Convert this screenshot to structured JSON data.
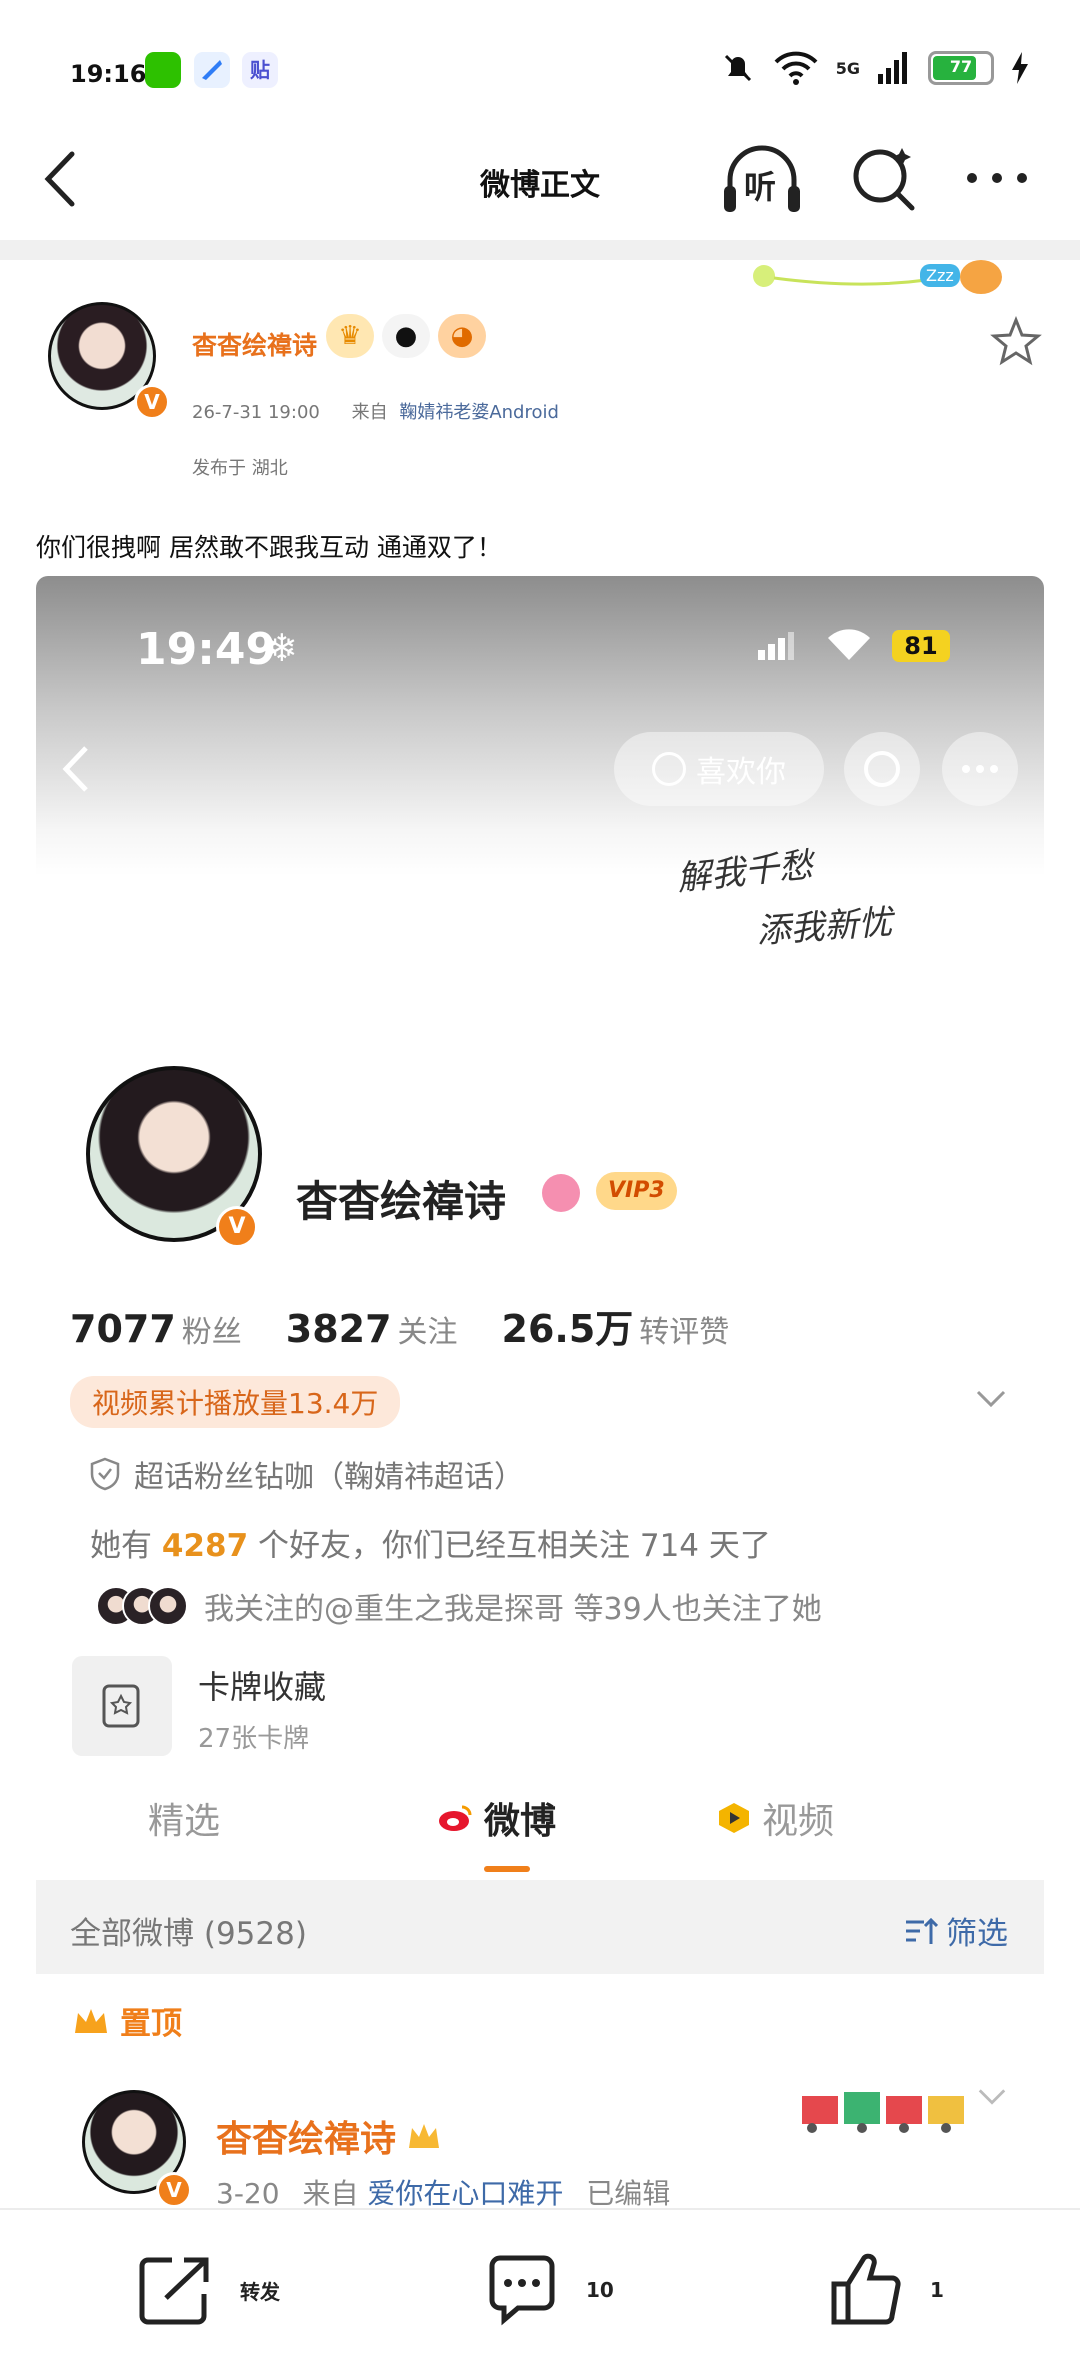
{
  "status_bar": {
    "time": "19:16",
    "tie_icon_text": "贴",
    "network": "5G",
    "battery": 77,
    "battery_text": "77"
  },
  "nav": {
    "title": "微博正文",
    "listen_label": "听"
  },
  "post": {
    "username": "杳杳绘禕诗",
    "meta_time": "26-7-31 19:00",
    "meta_from": "来自",
    "source": "鞠婧祎老婆Android",
    "location": "发布于 湖北",
    "text": "你们很拽啊 居然敢不跟我互动 通通双了！"
  },
  "screenshot": {
    "time": "19:49",
    "battery": "81",
    "like_button": "喜欢你",
    "calligraphy": [
      "解我千愁",
      "添我新忧"
    ],
    "profile_name": "杳杳绘禕诗",
    "vip": "VIP3",
    "stats": [
      {
        "num": "7077",
        "label": "粉丝"
      },
      {
        "num": "3827",
        "label": "关注"
      },
      {
        "num": "26.5万",
        "label": "转评赞"
      }
    ],
    "video_plays": "视频累计播放量13.4万",
    "super_topic": "超话粉丝钻咖（鞠婧祎超话）",
    "friends_prefix": "她有",
    "friends_count": "4287",
    "friends_mid": "个好友，你们已经互相关注",
    "friends_days": "714",
    "friends_suffix": "天了",
    "followed_by": "我关注的@重生之我是探哥 等39人也关注了她",
    "cards_title": "卡牌收藏",
    "cards_sub": "27张卡牌",
    "tabs": [
      "精选",
      "微博",
      "视频"
    ],
    "all_posts": "全部微博 (9528)",
    "filter": "筛选",
    "pinned": "置顶",
    "post_name": "杳杳绘禕诗",
    "post_date": "3-20",
    "post_from": "来自",
    "post_source": "爱你在心口难开",
    "post_edited": "已编辑"
  },
  "actions": {
    "repost": "转发",
    "comments": "10",
    "likes": "1"
  },
  "colors": {
    "accent": "#e8711c",
    "link": "#4b6a9b",
    "vip": "#ffd88a"
  }
}
